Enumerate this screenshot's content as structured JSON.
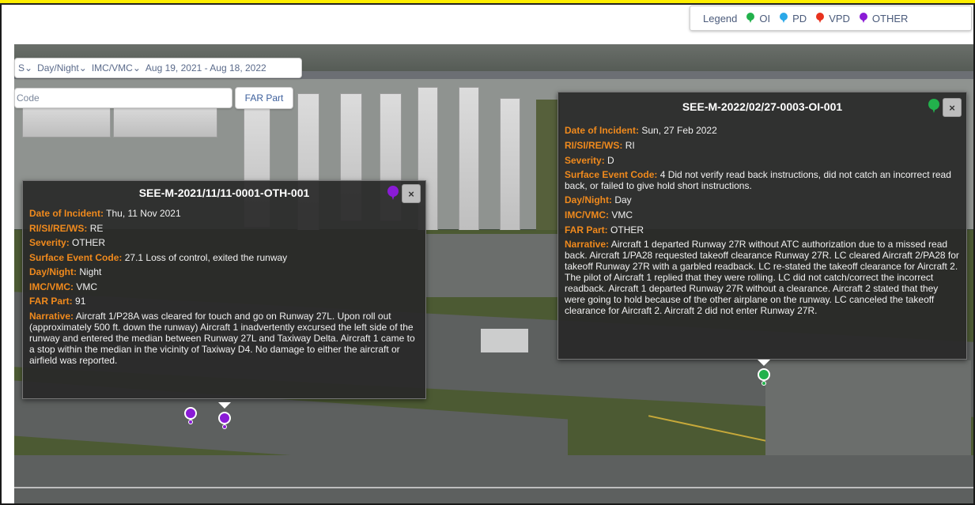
{
  "legend": {
    "title": "Legend",
    "items": [
      {
        "label": "OI",
        "color": "#22b14c"
      },
      {
        "label": "PD",
        "color": "#2aa8e8"
      },
      {
        "label": "VPD",
        "color": "#e8321e"
      },
      {
        "label": "OTHER",
        "color": "#8a1bd6"
      }
    ]
  },
  "filters": {
    "partial": "S",
    "day_night": "Day/Night",
    "imc_vmc": "IMC/VMC",
    "date_range": "Aug 19, 2021 - Aug 18, 2022"
  },
  "search": {
    "value": "Code"
  },
  "far_button": "FAR Part",
  "popup_left": {
    "title": "SEE-M-2021/11/11-0001-OTH-001",
    "pin_color": "#8a1bd6",
    "close": "×",
    "fields": [
      {
        "label": "Date of Incident:",
        "value": "Thu, 11 Nov 2021"
      },
      {
        "label": "RI/SI/RE/WS:",
        "value": "RE"
      },
      {
        "label": "Severity:",
        "value": "OTHER"
      },
      {
        "label": "Surface Event Code:",
        "value": "27.1 Loss of control, exited the runway"
      },
      {
        "label": "Day/Night:",
        "value": "Night"
      },
      {
        "label": "IMC/VMC:",
        "value": "VMC"
      },
      {
        "label": "FAR Part:",
        "value": "91"
      }
    ],
    "narrative_label": "Narrative:",
    "narrative": "Aircraft 1/P28A was cleared for touch and go on Runway 27L. Upon roll out (approximately 500 ft. down the runway) Aircraft 1 inadvertently excursed the left side of the runway and entered the median between Runway 27L and Taxiway Delta. Aircraft 1 came to a stop within the median in the vicinity of Taxiway D4. No damage to either the aircraft or airfield was reported."
  },
  "popup_right": {
    "title": "SEE-M-2022/02/27-0003-OI-001",
    "pin_color": "#22b14c",
    "close": "×",
    "fields": [
      {
        "label": "Date of Incident:",
        "value": "Sun, 27 Feb 2022"
      },
      {
        "label": "RI/SI/RE/WS:",
        "value": "RI"
      },
      {
        "label": "Severity:",
        "value": "D"
      },
      {
        "label": "Surface Event Code:",
        "value": "4 Did not verify read back instructions, did not catch an incorrect read back, or failed to give hold short instructions."
      },
      {
        "label": "Day/Night:",
        "value": "Day"
      },
      {
        "label": "IMC/VMC:",
        "value": "VMC"
      },
      {
        "label": "FAR Part:",
        "value": "OTHER"
      }
    ],
    "narrative_label": "Narrative:",
    "narrative": "Aircraft 1 departed Runway 27R without ATC authorization due to a missed read back. Aircraft 1/PA28 requested takeoff clearance Runway 27R. LC cleared Aircraft 2/PA28 for takeoff Runway 27R with a garbled readback. LC re-stated the takeoff clearance for Aircraft 2. The pilot of Aircraft 1 replied that they were rolling. LC did not catch/correct the incorrect readback. Aircraft 1 departed Runway 27R without a clearance. Aircraft 2 stated that they were going to hold because of the other airplane on the runway. LC canceled the takeoff clearance for Aircraft 2. Aircraft 2 did not enter Runway 27R."
  },
  "markers": [
    {
      "color": "#8a1bd6"
    },
    {
      "color": "#8a1bd6"
    },
    {
      "color": "#22b14c"
    }
  ]
}
